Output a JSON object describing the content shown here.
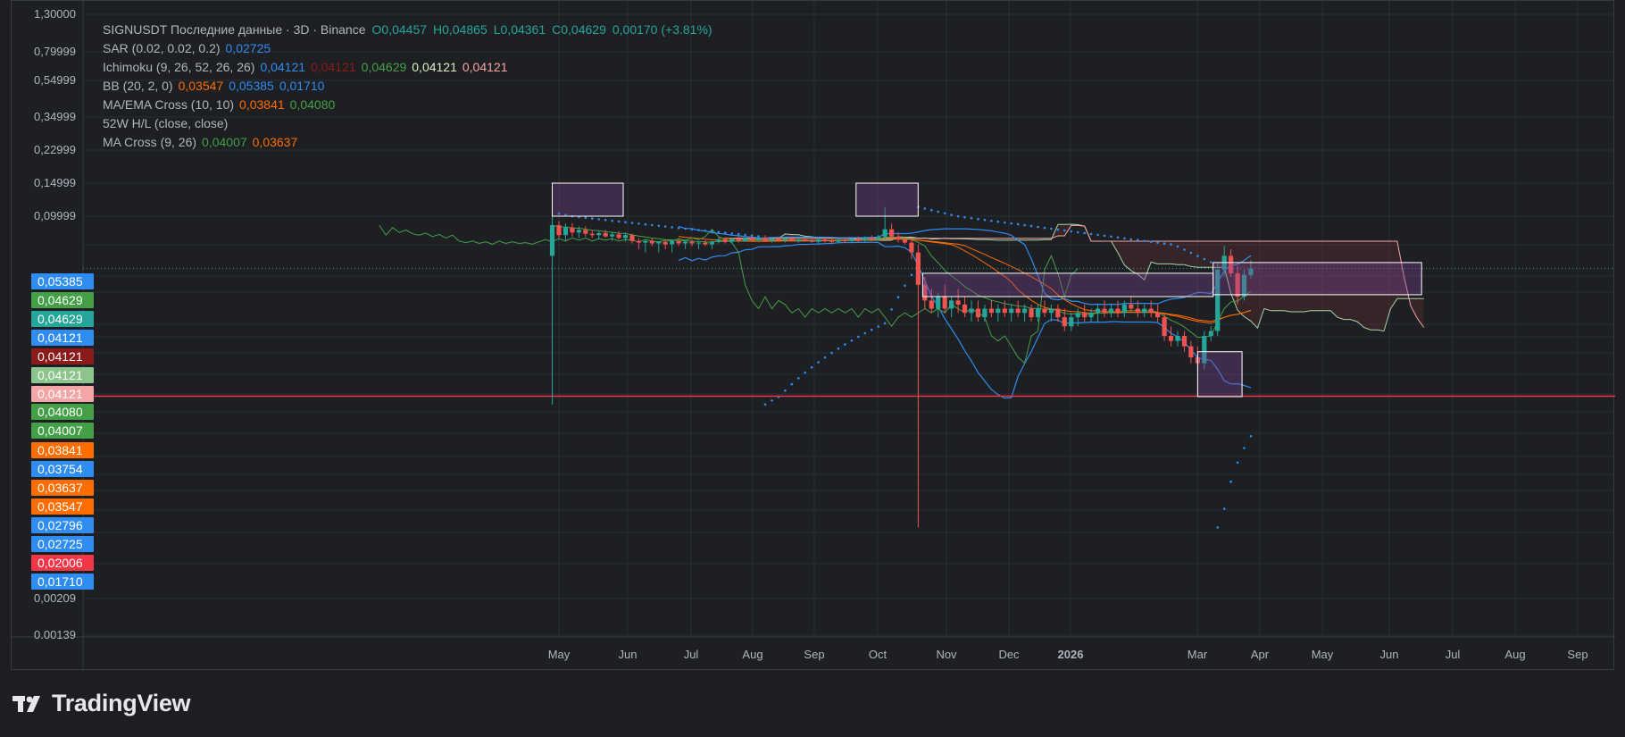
{
  "header": {
    "symbol_line": [
      {
        "text": "SIGNUSDT Последние данные · 3D · Binance",
        "color": "#b2b5be"
      },
      {
        "text": "O0,04457",
        "color": "#26a69a"
      },
      {
        "text": "H0,04865",
        "color": "#26a69a"
      },
      {
        "text": "L0,04361",
        "color": "#26a69a"
      },
      {
        "text": "C0,04629",
        "color": "#26a69a"
      },
      {
        "text": "0,00170 (+3.81%)",
        "color": "#26a69a"
      }
    ]
  },
  "indicators": [
    {
      "name": "SAR (0.02, 0.02, 0.2)",
      "values": [
        {
          "v": "0,02725",
          "color": "#2f8cf0"
        }
      ]
    },
    {
      "name": "Ichimoku (9, 26, 52, 26, 26)",
      "values": [
        {
          "v": "0,04121",
          "color": "#2f8cf0"
        },
        {
          "v": "0,04121",
          "color": "#8b1a1a"
        },
        {
          "v": "0,04629",
          "color": "#43a047"
        },
        {
          "v": "0,04121",
          "color": "#d7f0c4"
        },
        {
          "v": "0,04121",
          "color": "#f4a6a6"
        }
      ]
    },
    {
      "name": "BB (20, 2, 0)",
      "values": [
        {
          "v": "0,03547",
          "color": "#ff6d00"
        },
        {
          "v": "0,05385",
          "color": "#2f8cf0"
        },
        {
          "v": "0,01710",
          "color": "#2f8cf0"
        }
      ]
    },
    {
      "name": "MA/EMA Cross (10, 10)",
      "values": [
        {
          "v": "0,03841",
          "color": "#ff6d00"
        },
        {
          "v": "0,04080",
          "color": "#43a047"
        }
      ]
    },
    {
      "name": "52W H/L (close, close)",
      "values": []
    },
    {
      "name": "MA Cross (9, 26)",
      "values": [
        {
          "v": "0,04007",
          "color": "#43a047"
        },
        {
          "v": "0,03637",
          "color": "#ff6d00"
        }
      ]
    }
  ],
  "price_axis": {
    "tick_labels": [
      "1,30000",
      "0,79999",
      "0,54999",
      "0,34999",
      "0,22999",
      "0,14999",
      "0,09999",
      "0,00209",
      "0.00139"
    ],
    "badges": [
      {
        "label": "0,05385",
        "color": "#2f8cf0"
      },
      {
        "label": "0,04629",
        "color": "#43a047"
      },
      {
        "label": "0,04629",
        "color": "#26a69a"
      },
      {
        "label": "0,04121",
        "color": "#2f8cf0"
      },
      {
        "label": "0,04121",
        "color": "#8b1a1a"
      },
      {
        "label": "0,04121",
        "color": "#8bc58b"
      },
      {
        "label": "0,04121",
        "color": "#f4a6a6"
      },
      {
        "label": "0,04080",
        "color": "#43a047"
      },
      {
        "label": "0,04007",
        "color": "#43a047"
      },
      {
        "label": "0,03841",
        "color": "#ff6d00"
      },
      {
        "label": "0,03754",
        "color": "#2f8cf0"
      },
      {
        "label": "0,03637",
        "color": "#ff6d00"
      },
      {
        "label": "0,03547",
        "color": "#ff6d00"
      },
      {
        "label": "0,02796",
        "color": "#2f8cf0"
      },
      {
        "label": "0,02725",
        "color": "#2f8cf0"
      },
      {
        "label": "0,02006",
        "color": "#f23645"
      },
      {
        "label": "0,01710",
        "color": "#2f8cf0"
      }
    ]
  },
  "time_axis": {
    "labels": [
      "May",
      "Jun",
      "Jul",
      "Aug",
      "Sep",
      "Oct",
      "Nov",
      "Dec",
      "2026",
      "Mar",
      "Apr",
      "May",
      "Jun",
      "Jul",
      "Aug",
      "Sep"
    ]
  },
  "brand": {
    "name": "TradingView"
  },
  "colors": {
    "up": "#26a69a",
    "down": "#ef5350",
    "grid": "#2a2e39",
    "background": "#1e1f23",
    "hline": "#f23645",
    "sar": "#2f8cf0",
    "bb": "#2f8cf0",
    "basis": "#ff6d00",
    "chikou": "#43a047",
    "cloud": "#8b3a3a"
  },
  "chart_data": {
    "type": "candlestick",
    "symbol": "SIGNUSDT",
    "interval": "3D",
    "exchange": "Binance",
    "last": {
      "open": 0.04457,
      "high": 0.04865,
      "low": 0.04361,
      "close": 0.04629,
      "change": 0.0017,
      "change_pct": 3.81
    },
    "y_scale": "log",
    "horizontal_line": 0.02006,
    "series": [
      {
        "x": "2025-04-28",
        "open": 0.05,
        "high": 0.105,
        "low": 0.018,
        "close": 0.082
      },
      {
        "x": "2025-05-01",
        "open": 0.082,
        "high": 0.09,
        "low": 0.062,
        "close": 0.066
      },
      {
        "x": "2025-05-04",
        "open": 0.066,
        "high": 0.085,
        "low": 0.058,
        "close": 0.078
      },
      {
        "x": "2025-05-07",
        "open": 0.078,
        "high": 0.086,
        "low": 0.064,
        "close": 0.07
      },
      {
        "x": "2025-05-10",
        "open": 0.07,
        "high": 0.08,
        "low": 0.062,
        "close": 0.074
      },
      {
        "x": "2025-05-13",
        "open": 0.074,
        "high": 0.08,
        "low": 0.064,
        "close": 0.068
      },
      {
        "x": "2025-05-16",
        "open": 0.068,
        "high": 0.074,
        "low": 0.062,
        "close": 0.066
      },
      {
        "x": "2025-05-19",
        "open": 0.066,
        "high": 0.072,
        "low": 0.06,
        "close": 0.069
      },
      {
        "x": "2025-05-22",
        "open": 0.069,
        "high": 0.074,
        "low": 0.062,
        "close": 0.064
      },
      {
        "x": "2025-05-25",
        "open": 0.064,
        "high": 0.07,
        "low": 0.058,
        "close": 0.067
      },
      {
        "x": "2025-05-28",
        "open": 0.067,
        "high": 0.072,
        "low": 0.06,
        "close": 0.062
      },
      {
        "x": "2025-05-31",
        "open": 0.062,
        "high": 0.07,
        "low": 0.057,
        "close": 0.066
      },
      {
        "x": "2025-06-03",
        "open": 0.066,
        "high": 0.068,
        "low": 0.055,
        "close": 0.058
      },
      {
        "x": "2025-06-06",
        "open": 0.058,
        "high": 0.062,
        "low": 0.052,
        "close": 0.056
      },
      {
        "x": "2025-06-09",
        "open": 0.056,
        "high": 0.06,
        "low": 0.051,
        "close": 0.058
      },
      {
        "x": "2025-06-12",
        "open": 0.058,
        "high": 0.062,
        "low": 0.053,
        "close": 0.055
      },
      {
        "x": "2025-06-15",
        "open": 0.055,
        "high": 0.058,
        "low": 0.051,
        "close": 0.057
      },
      {
        "x": "2025-06-18",
        "open": 0.057,
        "high": 0.06,
        "low": 0.052,
        "close": 0.054
      },
      {
        "x": "2025-06-21",
        "open": 0.054,
        "high": 0.06,
        "low": 0.051,
        "close": 0.058
      },
      {
        "x": "2025-06-24",
        "open": 0.058,
        "high": 0.061,
        "low": 0.053,
        "close": 0.055
      },
      {
        "x": "2025-06-27",
        "open": 0.055,
        "high": 0.059,
        "low": 0.052,
        "close": 0.057
      },
      {
        "x": "2025-06-30",
        "open": 0.057,
        "high": 0.06,
        "low": 0.053,
        "close": 0.055
      },
      {
        "x": "2025-07-03",
        "open": 0.055,
        "high": 0.058,
        "low": 0.052,
        "close": 0.056
      },
      {
        "x": "2025-07-06",
        "open": 0.056,
        "high": 0.059,
        "low": 0.053,
        "close": 0.054
      },
      {
        "x": "2025-07-09",
        "open": 0.054,
        "high": 0.058,
        "low": 0.052,
        "close": 0.057
      },
      {
        "x": "2025-07-12",
        "open": 0.057,
        "high": 0.062,
        "low": 0.055,
        "close": 0.06
      },
      {
        "x": "2025-07-15",
        "open": 0.06,
        "high": 0.063,
        "low": 0.055,
        "close": 0.057
      },
      {
        "x": "2025-07-18",
        "open": 0.057,
        "high": 0.062,
        "low": 0.055,
        "close": 0.061
      },
      {
        "x": "2025-07-21",
        "open": 0.061,
        "high": 0.064,
        "low": 0.056,
        "close": 0.058
      },
      {
        "x": "2025-07-24",
        "open": 0.058,
        "high": 0.064,
        "low": 0.057,
        "close": 0.062
      },
      {
        "x": "2025-07-27",
        "open": 0.062,
        "high": 0.065,
        "low": 0.057,
        "close": 0.059
      },
      {
        "x": "2025-07-30",
        "open": 0.059,
        "high": 0.064,
        "low": 0.057,
        "close": 0.062
      },
      {
        "x": "2025-08-02",
        "open": 0.062,
        "high": 0.066,
        "low": 0.057,
        "close": 0.058
      },
      {
        "x": "2025-08-05",
        "open": 0.058,
        "high": 0.063,
        "low": 0.056,
        "close": 0.061
      },
      {
        "x": "2025-08-08",
        "open": 0.061,
        "high": 0.064,
        "low": 0.057,
        "close": 0.059
      },
      {
        "x": "2025-08-11",
        "open": 0.059,
        "high": 0.063,
        "low": 0.056,
        "close": 0.061
      },
      {
        "x": "2025-08-14",
        "open": 0.061,
        "high": 0.064,
        "low": 0.057,
        "close": 0.058
      },
      {
        "x": "2025-08-17",
        "open": 0.058,
        "high": 0.062,
        "low": 0.056,
        "close": 0.06
      },
      {
        "x": "2025-08-20",
        "open": 0.06,
        "high": 0.063,
        "low": 0.057,
        "close": 0.059
      },
      {
        "x": "2025-08-23",
        "open": 0.059,
        "high": 0.062,
        "low": 0.056,
        "close": 0.057
      },
      {
        "x": "2025-08-26",
        "open": 0.057,
        "high": 0.062,
        "low": 0.055,
        "close": 0.06
      },
      {
        "x": "2025-08-29",
        "open": 0.06,
        "high": 0.063,
        "low": 0.056,
        "close": 0.058
      },
      {
        "x": "2025-09-01",
        "open": 0.058,
        "high": 0.062,
        "low": 0.055,
        "close": 0.057
      },
      {
        "x": "2025-09-04",
        "open": 0.057,
        "high": 0.061,
        "low": 0.055,
        "close": 0.059
      },
      {
        "x": "2025-09-07",
        "open": 0.059,
        "high": 0.062,
        "low": 0.056,
        "close": 0.058
      },
      {
        "x": "2025-09-10",
        "open": 0.058,
        "high": 0.063,
        "low": 0.056,
        "close": 0.061
      },
      {
        "x": "2025-09-13",
        "open": 0.061,
        "high": 0.064,
        "low": 0.057,
        "close": 0.059
      },
      {
        "x": "2025-09-16",
        "open": 0.059,
        "high": 0.064,
        "low": 0.057,
        "close": 0.062
      },
      {
        "x": "2025-09-19",
        "open": 0.062,
        "high": 0.066,
        "low": 0.058,
        "close": 0.06
      },
      {
        "x": "2025-09-22",
        "open": 0.06,
        "high": 0.066,
        "low": 0.058,
        "close": 0.064
      },
      {
        "x": "2025-09-25",
        "open": 0.064,
        "high": 0.112,
        "low": 0.06,
        "close": 0.075
      },
      {
        "x": "2025-09-28",
        "open": 0.075,
        "high": 0.085,
        "low": 0.062,
        "close": 0.064
      },
      {
        "x": "2025-10-01",
        "open": 0.064,
        "high": 0.07,
        "low": 0.056,
        "close": 0.06
      },
      {
        "x": "2025-10-04",
        "open": 0.06,
        "high": 0.064,
        "low": 0.054,
        "close": 0.056
      },
      {
        "x": "2025-10-07",
        "open": 0.056,
        "high": 0.06,
        "low": 0.049,
        "close": 0.051
      },
      {
        "x": "2025-10-10",
        "open": 0.051,
        "high": 0.054,
        "low": 0.0035,
        "close": 0.042
      },
      {
        "x": "2025-10-13",
        "open": 0.042,
        "high": 0.044,
        "low": 0.036,
        "close": 0.038
      },
      {
        "x": "2025-10-16",
        "open": 0.038,
        "high": 0.041,
        "low": 0.035,
        "close": 0.036
      },
      {
        "x": "2025-10-19",
        "open": 0.036,
        "high": 0.04,
        "low": 0.034,
        "close": 0.039
      },
      {
        "x": "2025-10-22",
        "open": 0.039,
        "high": 0.042,
        "low": 0.035,
        "close": 0.036
      },
      {
        "x": "2025-10-25",
        "open": 0.036,
        "high": 0.039,
        "low": 0.034,
        "close": 0.038
      },
      {
        "x": "2025-10-28",
        "open": 0.038,
        "high": 0.041,
        "low": 0.035,
        "close": 0.037
      },
      {
        "x": "2025-10-31",
        "open": 0.037,
        "high": 0.039,
        "low": 0.034,
        "close": 0.035
      },
      {
        "x": "2025-11-03",
        "open": 0.035,
        "high": 0.038,
        "low": 0.033,
        "close": 0.036
      },
      {
        "x": "2025-11-06",
        "open": 0.036,
        "high": 0.038,
        "low": 0.033,
        "close": 0.034
      },
      {
        "x": "2025-11-09",
        "open": 0.034,
        "high": 0.037,
        "low": 0.033,
        "close": 0.036
      },
      {
        "x": "2025-11-12",
        "open": 0.036,
        "high": 0.038,
        "low": 0.034,
        "close": 0.035
      },
      {
        "x": "2025-11-15",
        "open": 0.035,
        "high": 0.037,
        "low": 0.033,
        "close": 0.036
      },
      {
        "x": "2025-11-18",
        "open": 0.036,
        "high": 0.038,
        "low": 0.034,
        "close": 0.035
      },
      {
        "x": "2025-11-21",
        "open": 0.035,
        "high": 0.037,
        "low": 0.033,
        "close": 0.036
      },
      {
        "x": "2025-11-24",
        "open": 0.036,
        "high": 0.038,
        "low": 0.034,
        "close": 0.035
      },
      {
        "x": "2025-11-27",
        "open": 0.035,
        "high": 0.037,
        "low": 0.033,
        "close": 0.036
      },
      {
        "x": "2025-11-30",
        "open": 0.036,
        "high": 0.037,
        "low": 0.033,
        "close": 0.034
      },
      {
        "x": "2025-12-03",
        "open": 0.034,
        "high": 0.037,
        "low": 0.033,
        "close": 0.036
      },
      {
        "x": "2025-12-06",
        "open": 0.036,
        "high": 0.038,
        "low": 0.034,
        "close": 0.035
      },
      {
        "x": "2025-12-09",
        "open": 0.035,
        "high": 0.037,
        "low": 0.033,
        "close": 0.036
      },
      {
        "x": "2025-12-12",
        "open": 0.036,
        "high": 0.037,
        "low": 0.033,
        "close": 0.034
      },
      {
        "x": "2025-12-15",
        "open": 0.034,
        "high": 0.036,
        "low": 0.031,
        "close": 0.032
      },
      {
        "x": "2025-12-18",
        "open": 0.032,
        "high": 0.035,
        "low": 0.031,
        "close": 0.034
      },
      {
        "x": "2025-12-21",
        "open": 0.034,
        "high": 0.036,
        "low": 0.032,
        "close": 0.035
      },
      {
        "x": "2025-12-24",
        "open": 0.035,
        "high": 0.037,
        "low": 0.033,
        "close": 0.034
      },
      {
        "x": "2025-12-27",
        "open": 0.034,
        "high": 0.036,
        "low": 0.033,
        "close": 0.035
      },
      {
        "x": "2025-12-30",
        "open": 0.035,
        "high": 0.037,
        "low": 0.033,
        "close": 0.036
      },
      {
        "x": "2026-01-02",
        "open": 0.036,
        "high": 0.038,
        "low": 0.034,
        "close": 0.035
      },
      {
        "x": "2026-01-05",
        "open": 0.035,
        "high": 0.037,
        "low": 0.034,
        "close": 0.036
      },
      {
        "x": "2026-01-08",
        "open": 0.036,
        "high": 0.038,
        "low": 0.034,
        "close": 0.035
      },
      {
        "x": "2026-01-11",
        "open": 0.035,
        "high": 0.038,
        "low": 0.034,
        "close": 0.037
      },
      {
        "x": "2026-01-14",
        "open": 0.037,
        "high": 0.039,
        "low": 0.035,
        "close": 0.036
      },
      {
        "x": "2026-01-17",
        "open": 0.036,
        "high": 0.038,
        "low": 0.034,
        "close": 0.035
      },
      {
        "x": "2026-01-20",
        "open": 0.035,
        "high": 0.037,
        "low": 0.034,
        "close": 0.036
      },
      {
        "x": "2026-01-23",
        "open": 0.036,
        "high": 0.038,
        "low": 0.034,
        "close": 0.035
      },
      {
        "x": "2026-01-26",
        "open": 0.035,
        "high": 0.037,
        "low": 0.033,
        "close": 0.034
      },
      {
        "x": "2026-01-29",
        "open": 0.034,
        "high": 0.035,
        "low": 0.029,
        "close": 0.03
      },
      {
        "x": "2026-02-01",
        "open": 0.03,
        "high": 0.032,
        "low": 0.028,
        "close": 0.029
      },
      {
        "x": "2026-02-04",
        "open": 0.029,
        "high": 0.031,
        "low": 0.028,
        "close": 0.03
      },
      {
        "x": "2026-02-07",
        "open": 0.03,
        "high": 0.031,
        "low": 0.027,
        "close": 0.028
      },
      {
        "x": "2026-02-10",
        "open": 0.028,
        "high": 0.029,
        "low": 0.025,
        "close": 0.026
      },
      {
        "x": "2026-02-13",
        "open": 0.026,
        "high": 0.028,
        "low": 0.024,
        "close": 0.025
      },
      {
        "x": "2026-02-16",
        "open": 0.025,
        "high": 0.031,
        "low": 0.024,
        "close": 0.03
      },
      {
        "x": "2026-02-19",
        "open": 0.03,
        "high": 0.032,
        "low": 0.029,
        "close": 0.031
      },
      {
        "x": "2026-02-22",
        "open": 0.031,
        "high": 0.048,
        "low": 0.03,
        "close": 0.046
      },
      {
        "x": "2026-02-25",
        "open": 0.046,
        "high": 0.053,
        "low": 0.044,
        "close": 0.05
      },
      {
        "x": "2026-02-28",
        "open": 0.05,
        "high": 0.052,
        "low": 0.044,
        "close": 0.045
      },
      {
        "x": "2026-03-03",
        "open": 0.045,
        "high": 0.047,
        "low": 0.037,
        "close": 0.039
      },
      {
        "x": "2026-03-06",
        "open": 0.039,
        "high": 0.046,
        "low": 0.038,
        "close": 0.0446
      },
      {
        "x": "2026-03-09",
        "open": 0.04457,
        "high": 0.04865,
        "low": 0.04361,
        "close": 0.04629
      }
    ]
  }
}
